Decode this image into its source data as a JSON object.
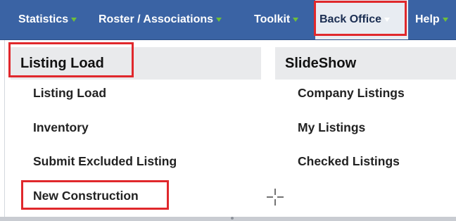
{
  "nav": {
    "items": [
      {
        "label": "Statistics"
      },
      {
        "label": "Roster / Associations"
      },
      {
        "label": "Toolkit"
      },
      {
        "label": "Back Office"
      },
      {
        "label": "Help"
      }
    ],
    "active": "Back Office",
    "colors": {
      "bar": "#3a63a4",
      "arrow": "#6fbf3a",
      "highlight": "#e0282c"
    }
  },
  "dropdown": {
    "columns": [
      {
        "header": "Listing Load",
        "items": [
          "Listing Load",
          "Inventory",
          "Submit Excluded Listing",
          "New Construction"
        ]
      },
      {
        "header": "SlideShow",
        "items": [
          "Company Listings",
          "My Listings",
          "Checked Listings"
        ]
      }
    ]
  },
  "cursor": {
    "icon": "crosshair-cursor-icon"
  }
}
